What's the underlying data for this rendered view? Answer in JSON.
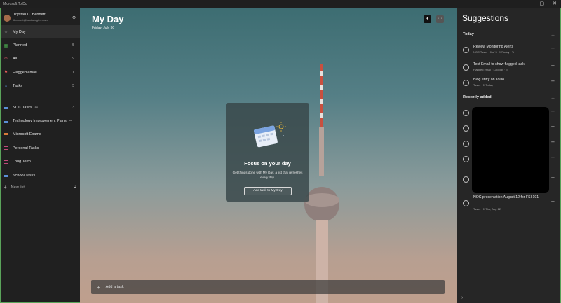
{
  "window": {
    "title": "Microsoft To Do",
    "controls": [
      "–",
      "▢",
      "✕"
    ]
  },
  "user": {
    "name": "Trystan C. Bennett",
    "email": "tbennett@hcstrategies.com"
  },
  "nav": [
    {
      "label": "My Day",
      "count": "",
      "icon": "sun-icon",
      "color": "#9a9a9a"
    },
    {
      "label": "Planned",
      "count": "5",
      "icon": "calendar-icon",
      "color": "#4caf50"
    },
    {
      "label": "All",
      "count": "9",
      "icon": "infinity-icon",
      "color": "#e05a6a"
    },
    {
      "label": "Flagged email",
      "count": "1",
      "icon": "flag-icon",
      "color": "#e05a5a"
    },
    {
      "label": "Tasks",
      "count": "5",
      "icon": "home-icon",
      "color": "#5b8fd6"
    }
  ],
  "lists": [
    {
      "label": "NOC Tasks",
      "count": "3",
      "shared": true,
      "color": "#5b8fd6"
    },
    {
      "label": "Technology Improvement Plans",
      "count": "",
      "shared": true,
      "color": "#5b8fd6"
    },
    {
      "label": "Microsoft Exams",
      "count": "",
      "shared": false,
      "color": "#d87a3a"
    },
    {
      "label": "Personal Tasks",
      "count": "",
      "shared": false,
      "color": "#c24a7a"
    },
    {
      "label": "Long Term",
      "count": "",
      "shared": false,
      "color": "#c24a7a"
    },
    {
      "label": "School Tasks",
      "count": "",
      "shared": false,
      "color": "#5b8fd6"
    }
  ],
  "new_list": {
    "label": "New list"
  },
  "main": {
    "title": "My Day",
    "date": "Friday, July 30",
    "focus_title": "Focus on your day",
    "focus_desc": "Get things done with My Day, a list that refreshes every day.",
    "focus_button": "Add task to My Day",
    "add_task": "Add a task"
  },
  "suggestions": {
    "title": "Suggestions",
    "today_label": "Today",
    "recent_label": "Recently added",
    "today": [
      {
        "title": "Review Monitoring Alerts",
        "meta": "NOC Tasks · 0 of 5 · ☐Today · ↻"
      },
      {
        "title": "Test Email to show flagged task",
        "meta": "Flagged email · ☐Today · ▭"
      },
      {
        "title": "Blog entry on ToDo",
        "meta": "Tasks · ☐Today"
      }
    ],
    "recent_last": {
      "title": "NOC presentation August 12 for FSI 101",
      "meta": "Tasks · ☐Thu, Aug 12"
    }
  }
}
